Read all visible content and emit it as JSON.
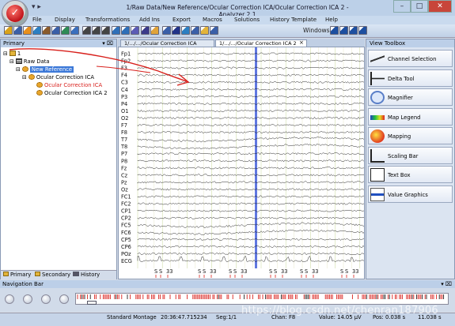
{
  "app": {
    "title": "1/Raw Data/New Reference/Ocular Correction ICA/Ocular Correction ICA 2 - Analyzer 2.1",
    "logo_glyph": "✓",
    "quick_access": "▾ ▸",
    "window_buttons": {
      "minimize": "–",
      "maximize": "□",
      "close": "✕"
    }
  },
  "menu": [
    "File",
    "Display",
    "Transformations",
    "Add Ins",
    "Export",
    "Macros",
    "Solutions",
    "History Template",
    "Help"
  ],
  "toolbar": {
    "windows_label": "Windows",
    "icons": [
      "open-icon",
      "tree-icon",
      "gear-icon",
      "globe-icon",
      "cube-icon",
      "select-icon",
      "chart-icon",
      "grid-icon",
      "down-arrow-icon",
      "up-arrow-icon",
      "left-arrow-icon",
      "undo-icon",
      "redo-icon",
      "filter-icon",
      "monitor-icon",
      "page-icon",
      "r-icon",
      "m-icon",
      "wave-icon",
      "table-icon",
      "marker-icon",
      "zoom-icon",
      "cascade-icon",
      "tile-icon",
      "window-icon",
      "list-icon"
    ]
  },
  "primary": {
    "header": "Primary",
    "pin": "▾ ⌧",
    "tree": [
      {
        "label": "1",
        "icon": "folder-icon",
        "depth": 0,
        "expander": "⊟"
      },
      {
        "label": "Raw Data",
        "icon": "data-icon",
        "depth": 1,
        "expander": "⊟"
      },
      {
        "label": "New Reference",
        "icon": "gear-icon",
        "depth": 2,
        "expander": "⊟",
        "selected": true
      },
      {
        "label": "Ocular Correction ICA",
        "icon": "gear-icon",
        "depth": 3,
        "expander": "⊟"
      },
      {
        "label": "Ocular Correction ICA",
        "icon": "gear-icon",
        "depth": 4,
        "red": true
      },
      {
        "label": "Ocular Correction ICA 2",
        "icon": "gear-icon",
        "depth": 4
      }
    ],
    "tabs": [
      "Primary",
      "Secondary",
      "History"
    ]
  },
  "documents": {
    "tabs": [
      "1/.../.../Ocular Correction ICA",
      "1/.../.../Ocular Correction ICA 2"
    ],
    "active": 1,
    "close_glyph": "×",
    "channels": [
      "Fp1",
      "Fp2",
      "F3",
      "F4",
      "C3",
      "C4",
      "P3",
      "P4",
      "O1",
      "O2",
      "F7",
      "F8",
      "T7",
      "T8",
      "P7",
      "P8",
      "Fz",
      "Cz",
      "Pz",
      "Oz",
      "FC1",
      "FC2",
      "CP1",
      "CP2",
      "FC5",
      "FC6",
      "CP5",
      "CP6",
      "POz",
      "ECG"
    ],
    "markers": [
      "S",
      "S",
      "33",
      "S",
      "S",
      "33",
      "S",
      "S",
      "33",
      "S",
      "S",
      "33",
      "S",
      "S",
      "33",
      "S",
      "S",
      "33"
    ]
  },
  "toolbox": {
    "header": "View Toolbox",
    "items": [
      {
        "label": "Channel Selection",
        "icon": "channel-selection-icon"
      },
      {
        "label": "Delta Tool",
        "icon": "delta-tool-icon"
      },
      {
        "label": "Magnifier",
        "icon": "magnifier-icon"
      },
      {
        "label": "Map Legend",
        "icon": "map-legend-icon"
      },
      {
        "label": "Mapping",
        "icon": "mapping-icon"
      },
      {
        "label": "Scaling Bar",
        "icon": "scaling-bar-icon"
      },
      {
        "label": "Text Box",
        "icon": "text-box-icon"
      },
      {
        "label": "Value Graphics",
        "icon": "value-graphics-icon"
      }
    ]
  },
  "navigation": {
    "header": "Navigation Bar",
    "pin": "▾ ⌧"
  },
  "status": {
    "montage": "Standard Montage",
    "time": "20:36:47.715234",
    "seg": "Seg:1/1",
    "chan": "Chan: F8",
    "value": "Value: 14.05 µV",
    "pos": "Pos: 0.038 s",
    "time2": "11.038 s"
  },
  "watermark": "https://blog.csdn.net/chenran187906",
  "colors": {
    "accent": "#3b78d8",
    "red": "#d8201c",
    "cursor": "#3a56d8"
  }
}
